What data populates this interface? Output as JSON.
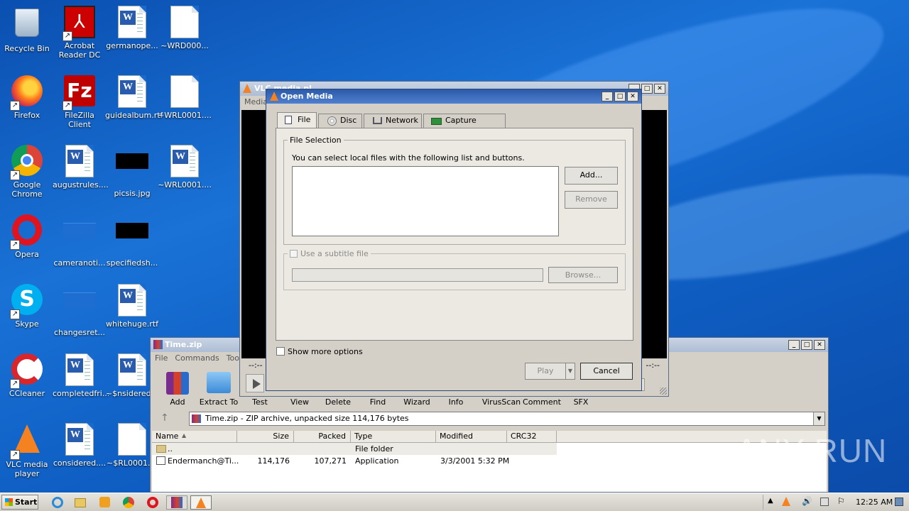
{
  "desktop_icons": [
    {
      "label": "Recycle Bin"
    },
    {
      "label": "Acrobat\nReader DC"
    },
    {
      "label": "germanope..."
    },
    {
      "label": "~WRD000..."
    },
    {
      "label": "Firefox"
    },
    {
      "label": "FileZilla Client"
    },
    {
      "label": "guidealbum.rtf"
    },
    {
      "label": "~WRL0001...."
    },
    {
      "label": "Google\nChrome"
    },
    {
      "label": "augustrules...."
    },
    {
      "label": "picsis.jpg"
    },
    {
      "label": "~WRL0001...."
    },
    {
      "label": "Opera"
    },
    {
      "label": "cameranoti..."
    },
    {
      "label": "specifiedsh..."
    },
    {
      "label": "Skype"
    },
    {
      "label": "changesret..."
    },
    {
      "label": "whitehuge.rtf"
    },
    {
      "label": "CCleaner"
    },
    {
      "label": "completedfri..."
    },
    {
      "label": "~$nsidered..."
    },
    {
      "label": "VLC media\nplayer"
    },
    {
      "label": "considered...."
    },
    {
      "label": "~$RL0001...."
    }
  ],
  "vlc_main": {
    "title": "VLC media pl...",
    "menu": "Media",
    "time_left": "--:--",
    "time_right": "--:--"
  },
  "open_media": {
    "title": "Open Media",
    "tabs": [
      {
        "label": "File"
      },
      {
        "label": "Disc"
      },
      {
        "label": "Network"
      },
      {
        "label": "Capture Device"
      }
    ],
    "file_selection_legend": "File Selection",
    "instruction": "You can select local files with the following list and buttons.",
    "add_button": "Add...",
    "remove_button": "Remove",
    "subtitle_label": "Use a subtitle file",
    "browse_button": "Browse...",
    "show_more": "Show more options",
    "play_button": "Play",
    "cancel_button": "Cancel"
  },
  "winrar": {
    "title": "Time.zip",
    "menu": [
      "File",
      "Commands",
      "Tools"
    ],
    "toolbar": [
      "Add",
      "Extract To",
      "Test",
      "View",
      "Delete",
      "Find",
      "Wizard",
      "Info",
      "VirusScan",
      "Comment",
      "SFX"
    ],
    "path": "Time.zip - ZIP archive, unpacked size 114,176 bytes",
    "columns": [
      "Name",
      "Size",
      "Packed",
      "Type",
      "Modified",
      "CRC32"
    ],
    "rows": [
      {
        "name": "..",
        "size": "",
        "packed": "",
        "type": "File folder",
        "modified": "",
        "crc": ""
      },
      {
        "name": "Endermanch@Ti...",
        "size": "114,176",
        "packed": "107,271",
        "type": "Application",
        "modified": "3/3/2001 5:32 PM",
        "crc": ""
      }
    ]
  },
  "watermark": "ANY RUN",
  "taskbar": {
    "start": "Start",
    "clock": "12:25 AM"
  }
}
